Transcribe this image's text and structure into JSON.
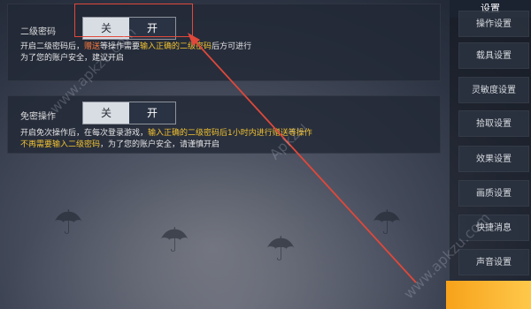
{
  "panels": {
    "second_password": {
      "label": "二级密码",
      "toggle": {
        "off": "关",
        "on": "开"
      },
      "desc": {
        "p1": "开启二级密码后，",
        "p2": "赠送",
        "p3": "等操作需要",
        "p4": "输入正确的二级密码",
        "p5": "后方可进行",
        "p6": "为了您的账户安全，建议开启"
      }
    },
    "skip_operation": {
      "label": "免密操作",
      "toggle": {
        "off": "关",
        "on": "开"
      },
      "desc": {
        "p1": "开启免次操作后，在每次登录游戏，",
        "p2": "输入正确的二级密码后1小时内进行赠送等操作",
        "p3": "不再需要输入二级密码",
        "p4": "，为了您的账户安全，请谨慎开启"
      }
    }
  },
  "sidebar": {
    "title": "设置",
    "items": [
      "操作设置",
      "载具设置",
      "灵敏度设置",
      "拾取设置",
      "效果设置",
      "画质设置",
      "快捷消息",
      "声音设置"
    ]
  },
  "watermarks": [
    "www.apkzu.com",
    "ApkZu",
    "www.apkzu.com"
  ],
  "colors": {
    "highlight_yellow": "#f2c230",
    "annotation_red": "#e0483a",
    "accent_orange": "#f7a21a"
  }
}
